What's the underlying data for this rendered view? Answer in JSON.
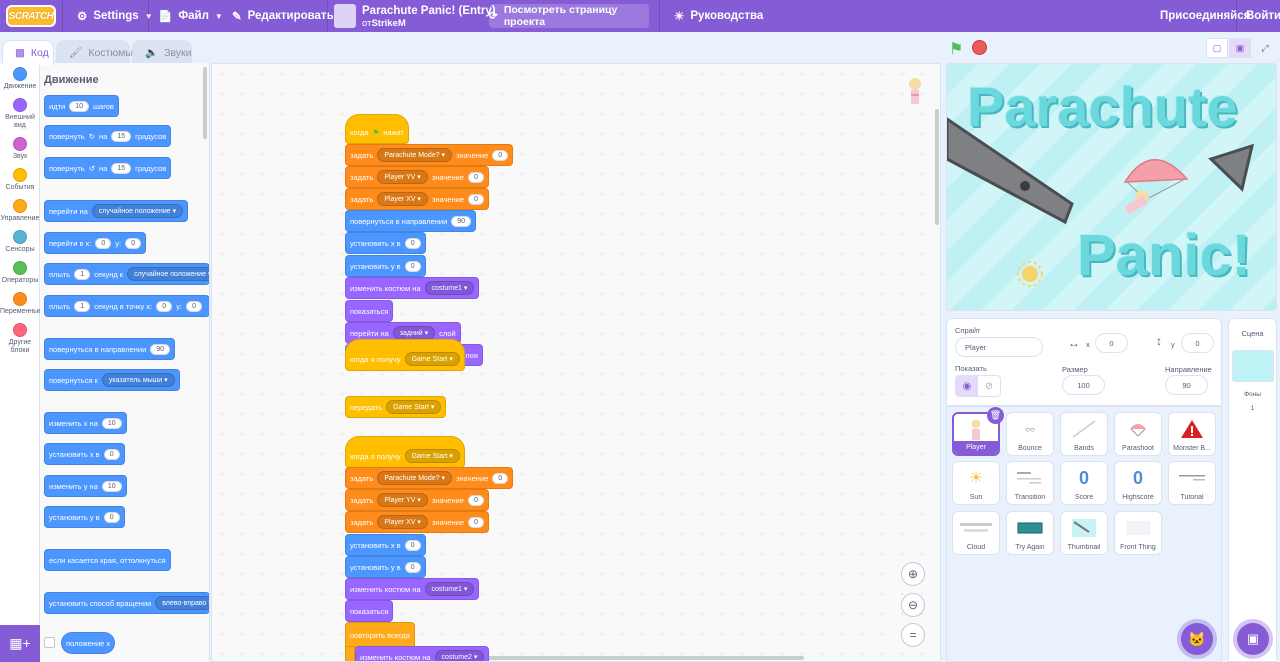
{
  "menubar": {
    "logo_text": "SCRATCH",
    "settings": "Settings",
    "file": "Файл",
    "edit": "Редактировать",
    "project_title": "Parachute Panic! (Entry)",
    "author_prefix": "от",
    "author": "StrikeM",
    "see_project": "Посмотреть страницу проекта",
    "tutorials": "Руководства",
    "join": "Присоединяйся",
    "signin": "Войти"
  },
  "tabs": {
    "code": "Код",
    "costumes": "Костюмы",
    "sounds": "Звуки"
  },
  "categories": [
    {
      "label": "Движение",
      "color": "#4c97ff"
    },
    {
      "label": "Внешний вид",
      "color": "#9966ff"
    },
    {
      "label": "Звук",
      "color": "#cf63cf"
    },
    {
      "label": "События",
      "color": "#ffbf00"
    },
    {
      "label": "Управление",
      "color": "#ffab19"
    },
    {
      "label": "Сенсоры",
      "color": "#5cb1d6"
    },
    {
      "label": "Операторы",
      "color": "#59c059"
    },
    {
      "label": "Переменные",
      "color": "#ff8c1a"
    },
    {
      "label": "Другие блоки",
      "color": "#ff6680"
    }
  ],
  "palette": {
    "heading": "Движение",
    "move": {
      "a": "идти",
      "val": "10",
      "b": "шагов"
    },
    "turn_right": {
      "a": "повернуть",
      "b": "на",
      "val": "15",
      "c": "градусов"
    },
    "turn_left": {
      "a": "повернуть",
      "b": "на",
      "val": "15",
      "c": "градусов"
    },
    "goto": {
      "a": "перейти на",
      "dd": "случайное положение"
    },
    "goto_xy": {
      "a": "перейти в x:",
      "x": "0",
      "b": "y:",
      "y": "0"
    },
    "glide": {
      "a": "плыть",
      "val": "1",
      "b": "секунд к",
      "dd": "случайное положение"
    },
    "glide_xy": {
      "a": "плыть",
      "val": "1",
      "b": "секунд в точку x:",
      "x": "0",
      "c": "y:",
      "y": "0"
    },
    "point_dir": {
      "a": "повернуться в направлении",
      "val": "90"
    },
    "point_to": {
      "a": "повернуться к",
      "dd": "указатель мыши"
    },
    "change_x": {
      "a": "изменить х на",
      "val": "10"
    },
    "set_x": {
      "a": "установить х в",
      "val": "0"
    },
    "change_y": {
      "a": "изменить у на",
      "val": "10"
    },
    "set_y": {
      "a": "установить у в",
      "val": "0"
    },
    "bounce": "если касается края, оттолкнуться",
    "rotation": {
      "a": "установить способ вращения",
      "dd": "влево-вправо"
    },
    "position_x": "положение х"
  },
  "script1": {
    "hat": {
      "a": "когда",
      "b": "нажат"
    },
    "set1": {
      "a": "задать",
      "var": "Parachute Mode?",
      "b": "значение",
      "val": "0"
    },
    "set2": {
      "a": "задать",
      "var": "Player YV",
      "b": "значение",
      "val": "0"
    },
    "set3": {
      "a": "задать",
      "var": "Player XV",
      "b": "значение",
      "val": "0"
    },
    "point": {
      "a": "повернуться в направлении",
      "val": "90"
    },
    "setx": {
      "a": "установить х в",
      "val": "0"
    },
    "sety": {
      "a": "установить у в",
      "val": "0"
    },
    "costume": {
      "a": "изменить костюм на",
      "dd": "costume1"
    },
    "show": "показаться",
    "layer": {
      "a": "перейти на",
      "dd": "задний",
      "b": "слой"
    },
    "layer_tail": "слоя"
  },
  "script_receive_overlap": {
    "a": "когда я получу",
    "dd": "Game Start"
  },
  "script_broadcast": {
    "a": "передать",
    "dd": "Game Start"
  },
  "script2": {
    "hat": {
      "a": "когда я получу",
      "dd": "Game Start"
    },
    "set1": {
      "a": "задать",
      "var": "Parachute Mode?",
      "b": "значение",
      "val": "0"
    },
    "set2": {
      "a": "задать",
      "var": "Player YV",
      "b": "значение",
      "val": "0"
    },
    "set3": {
      "a": "задать",
      "var": "Player XV",
      "b": "значение",
      "val": "0"
    },
    "setx": {
      "a": "установить х в",
      "val": "0"
    },
    "sety": {
      "a": "установить у в",
      "val": "0"
    },
    "costume": {
      "a": "изменить костюм на",
      "dd": "costume1"
    },
    "show": "показаться",
    "forever": "повторять всегда",
    "costume2": {
      "a": "изменить костюм на",
      "dd": "costume2"
    }
  },
  "stage": {
    "title1": "Parachute",
    "title2": "Panic!"
  },
  "sprite_info": {
    "sprite_label": "Спрайт",
    "sprite_name": "Player",
    "x_label": "x",
    "x": "0",
    "y_label": "y",
    "y": "0",
    "show_label": "Показать",
    "size_label": "Размер",
    "size": "100",
    "direction_label": "Направление",
    "direction": "90"
  },
  "sprites": [
    {
      "name": "Player"
    },
    {
      "name": "Bounce"
    },
    {
      "name": "Bands"
    },
    {
      "name": "Parashoot"
    },
    {
      "name": "Monster B..."
    },
    {
      "name": "Sun"
    },
    {
      "name": "Transition"
    },
    {
      "name": "Score",
      "glyph": "0"
    },
    {
      "name": "Highscore",
      "glyph": "0"
    },
    {
      "name": "Tutorial"
    },
    {
      "name": "Cloud"
    },
    {
      "name": "Try Again"
    },
    {
      "name": "Thumbnail"
    },
    {
      "name": "Front Thing"
    }
  ],
  "stage_pane": {
    "title": "Сцена",
    "backdrops_label": "Фоны",
    "backdrops_count": "1"
  },
  "colors": {
    "accent": "#855cd6",
    "motion": "#4c97ff",
    "looks": "#9966ff",
    "events": "#ffbf00",
    "control": "#ffab19",
    "variables": "#ff8c1a"
  }
}
